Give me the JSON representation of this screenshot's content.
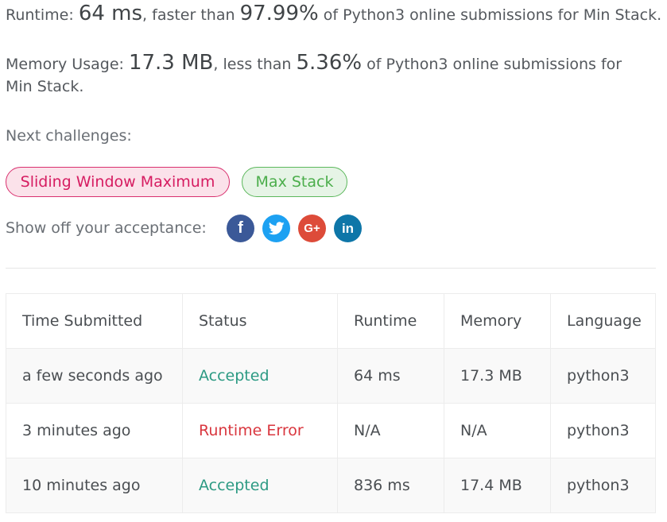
{
  "summary": {
    "runtime_label": "Runtime: ",
    "runtime_value": "64 ms",
    "runtime_faster": ", faster than ",
    "runtime_percent": "97.99%",
    "runtime_tail": " of Python3 online submissions for Min Stack.",
    "memory_label": "Memory Usage: ",
    "memory_value": "17.3 MB",
    "memory_less": ", less than ",
    "memory_percent": "5.36%",
    "memory_tail": " of Python3 online submissions for Min Stack."
  },
  "next": {
    "label": "Next challenges:",
    "challenges": [
      {
        "title": "Sliding Window Maximum",
        "color": "#d61c61"
      },
      {
        "title": "Max Stack",
        "color": "#4cae4c"
      }
    ]
  },
  "share": {
    "label": "Show off your acceptance:",
    "icons": [
      "facebook-icon",
      "twitter-icon",
      "google-plus-icon",
      "linkedin-icon"
    ],
    "glyphs": {
      "facebook": "f",
      "google_plus": "G+",
      "linkedin": "in"
    }
  },
  "table": {
    "headers": [
      "Time Submitted",
      "Status",
      "Runtime",
      "Memory",
      "Language"
    ],
    "rows": [
      {
        "time": "a few seconds ago",
        "status": "Accepted",
        "runtime": "64 ms",
        "memory": "17.3 MB",
        "language": "python3"
      },
      {
        "time": "3 minutes ago",
        "status": "Runtime Error",
        "runtime": "N/A",
        "memory": "N/A",
        "language": "python3"
      },
      {
        "time": "10 minutes ago",
        "status": "Accepted",
        "runtime": "836 ms",
        "memory": "17.4 MB",
        "language": "python3"
      }
    ]
  },
  "colors": {
    "accepted": "#2c9a83",
    "error": "#d9363e"
  }
}
